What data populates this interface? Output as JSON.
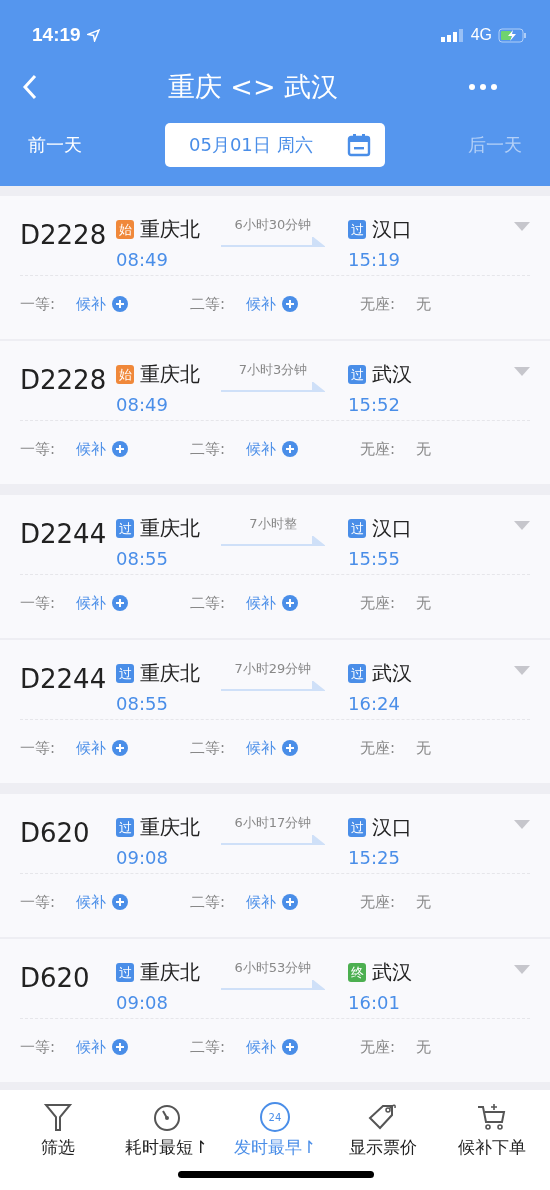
{
  "status_bar": {
    "time": "14:19",
    "network": "4G"
  },
  "header": {
    "title": "重庆 <> 武汉",
    "prev_day": {
      "label": "前一天",
      "disabled": false
    },
    "date": "05月01日 周六",
    "next_day": {
      "label": "后一天",
      "disabled": true
    }
  },
  "groups": [
    {
      "trains": [
        {
          "number": "D2228",
          "from": {
            "badge": "始",
            "kind": "start",
            "station": "重庆北",
            "time": "08:49"
          },
          "duration": "6小时30分钟",
          "to": {
            "badge": "过",
            "kind": "pass",
            "station": "汉口",
            "time": "15:19"
          },
          "seats": [
            {
              "label": "一等:",
              "value": "候补",
              "kind": "waitlist"
            },
            {
              "label": "二等:",
              "value": "候补",
              "kind": "waitlist"
            },
            {
              "label": "无座:",
              "value": "无",
              "kind": "none"
            }
          ]
        },
        {
          "number": "D2228",
          "from": {
            "badge": "始",
            "kind": "start",
            "station": "重庆北",
            "time": "08:49"
          },
          "duration": "7小时3分钟",
          "to": {
            "badge": "过",
            "kind": "pass",
            "station": "武汉",
            "time": "15:52"
          },
          "seats": [
            {
              "label": "一等:",
              "value": "候补",
              "kind": "waitlist"
            },
            {
              "label": "二等:",
              "value": "候补",
              "kind": "waitlist"
            },
            {
              "label": "无座:",
              "value": "无",
              "kind": "none"
            }
          ]
        }
      ]
    },
    {
      "trains": [
        {
          "number": "D2244",
          "from": {
            "badge": "过",
            "kind": "pass",
            "station": "重庆北",
            "time": "08:55"
          },
          "duration": "7小时整",
          "to": {
            "badge": "过",
            "kind": "pass",
            "station": "汉口",
            "time": "15:55"
          },
          "seats": [
            {
              "label": "一等:",
              "value": "候补",
              "kind": "waitlist"
            },
            {
              "label": "二等:",
              "value": "候补",
              "kind": "waitlist"
            },
            {
              "label": "无座:",
              "value": "无",
              "kind": "none"
            }
          ]
        },
        {
          "number": "D2244",
          "from": {
            "badge": "过",
            "kind": "pass",
            "station": "重庆北",
            "time": "08:55"
          },
          "duration": "7小时29分钟",
          "to": {
            "badge": "过",
            "kind": "pass",
            "station": "武汉",
            "time": "16:24"
          },
          "seats": [
            {
              "label": "一等:",
              "value": "候补",
              "kind": "waitlist"
            },
            {
              "label": "二等:",
              "value": "候补",
              "kind": "waitlist"
            },
            {
              "label": "无座:",
              "value": "无",
              "kind": "none"
            }
          ]
        }
      ]
    },
    {
      "trains": [
        {
          "number": "D620",
          "from": {
            "badge": "过",
            "kind": "pass",
            "station": "重庆北",
            "time": "09:08"
          },
          "duration": "6小时17分钟",
          "to": {
            "badge": "过",
            "kind": "pass",
            "station": "汉口",
            "time": "15:25"
          },
          "seats": [
            {
              "label": "一等:",
              "value": "候补",
              "kind": "waitlist"
            },
            {
              "label": "二等:",
              "value": "候补",
              "kind": "waitlist"
            },
            {
              "label": "无座:",
              "value": "无",
              "kind": "none"
            }
          ]
        },
        {
          "number": "D620",
          "from": {
            "badge": "过",
            "kind": "pass",
            "station": "重庆北",
            "time": "09:08"
          },
          "duration": "6小时53分钟",
          "to": {
            "badge": "终",
            "kind": "end",
            "station": "武汉",
            "time": "16:01"
          },
          "seats": [
            {
              "label": "一等:",
              "value": "候补",
              "kind": "waitlist"
            },
            {
              "label": "二等:",
              "value": "候补",
              "kind": "waitlist"
            },
            {
              "label": "无座:",
              "value": "无",
              "kind": "none"
            }
          ]
        }
      ]
    }
  ],
  "toolbar": [
    {
      "label": "筛选",
      "selected": false
    },
    {
      "label": "耗时最短",
      "arrow": "↾",
      "selected": false
    },
    {
      "label": "发时最早",
      "arrow": "↾",
      "icon_text": "24",
      "selected": true
    },
    {
      "label": "显示票价",
      "selected": false
    },
    {
      "label": "候补下单",
      "selected": false
    }
  ]
}
